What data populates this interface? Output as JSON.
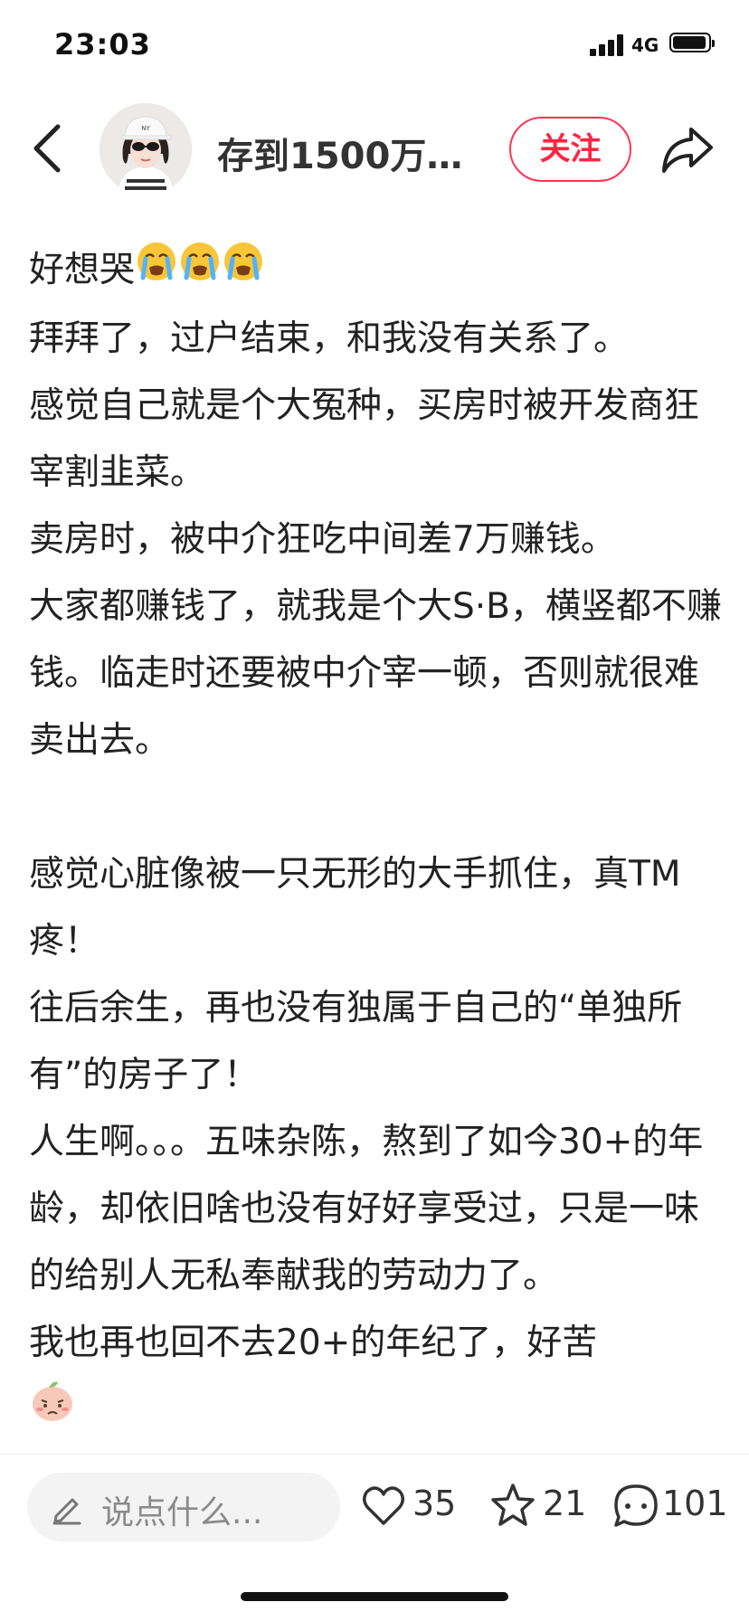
{
  "status": {
    "time": "23:03",
    "network": "4G",
    "battery_level": 0.95
  },
  "header": {
    "author": "存到1500万…",
    "follow_label": "关注"
  },
  "post": {
    "paragraphs": [
      "好想哭",
      "拜拜了，过户结束，和我没有关系了。",
      "感觉自己就是个大冤种，买房时被开发商狂宰割韭菜。",
      "卖房时，被中介狂吃中间差7万赚钱。",
      "大家都赚钱了，就我是个大S·B，横竖都不赚钱。临走时还要被中介宰一顿，否则就很难卖出去。",
      "",
      "感觉心脏像被一只无形的大手抓住，真TM疼！",
      "往后余生，再也没有独属于自己的“单独所有”的房子了！",
      "人生啊。。。五味杂陈，熬到了如今30+的年龄，却依旧啥也没有好好享受过，只是一味的给别人无私奉献我的劳动力了。",
      "我也再也回不去20+的年纪了，好苦"
    ],
    "first_line_emojis": [
      "loudly-crying-face",
      "loudly-crying-face",
      "loudly-crying-face"
    ],
    "last_emoji": "sad-peach-face"
  },
  "bottom_bar": {
    "comment_placeholder": "说点什么...",
    "likes": "35",
    "favorites": "21",
    "comments": "101"
  },
  "colors": {
    "accent": "#ff2442",
    "text": "#222222",
    "input_bg": "#f3f3f3"
  }
}
